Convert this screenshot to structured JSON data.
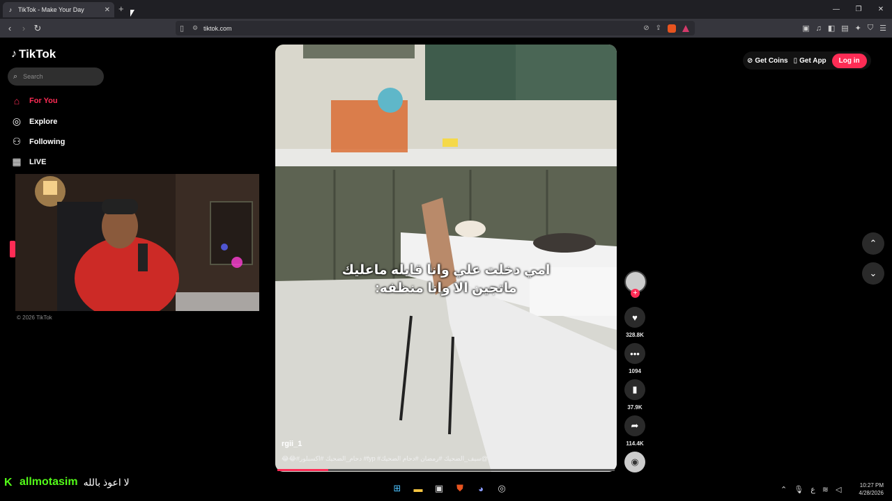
{
  "browser": {
    "tab_title": "TikTok - Make Your Day",
    "tab_close": "✕",
    "new_tab": "+",
    "url": "tiktok.com"
  },
  "sidebar": {
    "logo": "TikTok",
    "search_placeholder": "Search",
    "items": [
      {
        "label": "For You",
        "icon": "home-icon"
      },
      {
        "label": "Explore",
        "icon": "compass-icon"
      },
      {
        "label": "Following",
        "icon": "following-icon"
      },
      {
        "label": "LIVE",
        "icon": "live-icon"
      }
    ],
    "copyright": "© 2026 TikTok"
  },
  "video": {
    "caption_line1": "امي دخلت علي وانا قايله ماعليك",
    "caption_line2": "ماتجين الا وانا منظفه:",
    "author": "rgii_1",
    "tags": "😂😂#دحام_الضحيك #اكسبلور #fyp #سيف_الضحيك #رمضان #دحام الضحيك@",
    "progress": 0.15
  },
  "actions": {
    "likes": "328.8K",
    "comments": "1094",
    "saves": "37.9K",
    "shares": "114.4K"
  },
  "header": {
    "get_coins": "Get Coins",
    "get_app": "Get App",
    "login": "Log in"
  },
  "stream_overlay": {
    "username": "allmotasim",
    "message": "لا اعوذ بالله"
  },
  "taskbar": {
    "time": "10:27 PM",
    "date": "4/28/2026",
    "lang": "ع"
  },
  "colors": {
    "accent": "#fe2c55",
    "kick": "#53fc18"
  }
}
